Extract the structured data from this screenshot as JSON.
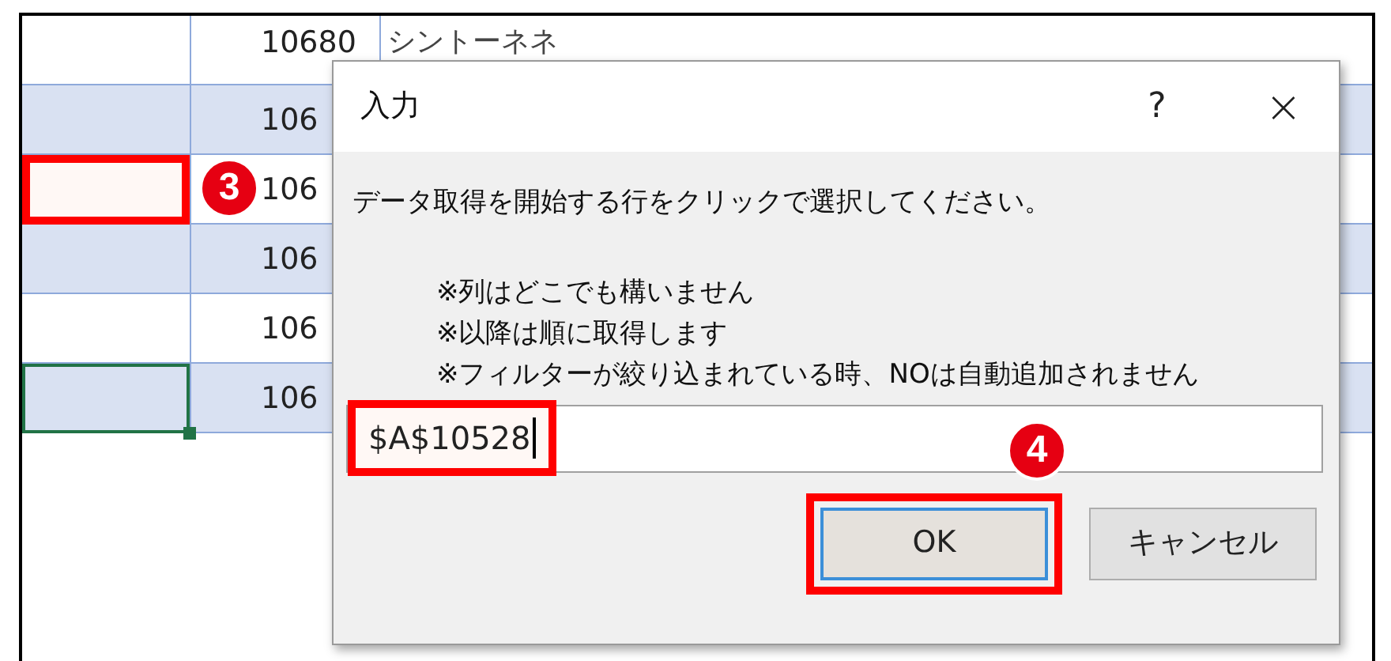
{
  "sheet": {
    "rows": [
      {
        "number": "10680",
        "name": "シントーネネ",
        "shaded": false,
        "selected": false,
        "highlighted": false
      },
      {
        "number": "106",
        "shaded": true,
        "selected": false,
        "highlighted": false
      },
      {
        "number": "106",
        "shaded": false,
        "selected": false,
        "highlighted": true,
        "callout": "3"
      },
      {
        "number": "106",
        "shaded": true,
        "selected": false,
        "highlighted": false
      },
      {
        "number": "106",
        "shaded": false,
        "selected": false,
        "highlighted": false
      },
      {
        "number": "106",
        "shaded": true,
        "selected": true,
        "highlighted": false
      }
    ]
  },
  "dialog": {
    "title": "入力",
    "help": "?",
    "close": "×",
    "message": "データ取得を開始する行をクリックで選択してください。",
    "notes": [
      "※列はどこでも構いません",
      "※以降は順に取得します",
      "※フィルターが絞り込まれている時、NOは自動追加されません"
    ],
    "input": {
      "value": "$A$10528",
      "highlighted": true
    },
    "buttons": [
      {
        "label": "OK",
        "default": true,
        "highlighted": true,
        "callout": "4"
      },
      {
        "label": "キャンセル",
        "default": false,
        "highlighted": false
      }
    ]
  }
}
